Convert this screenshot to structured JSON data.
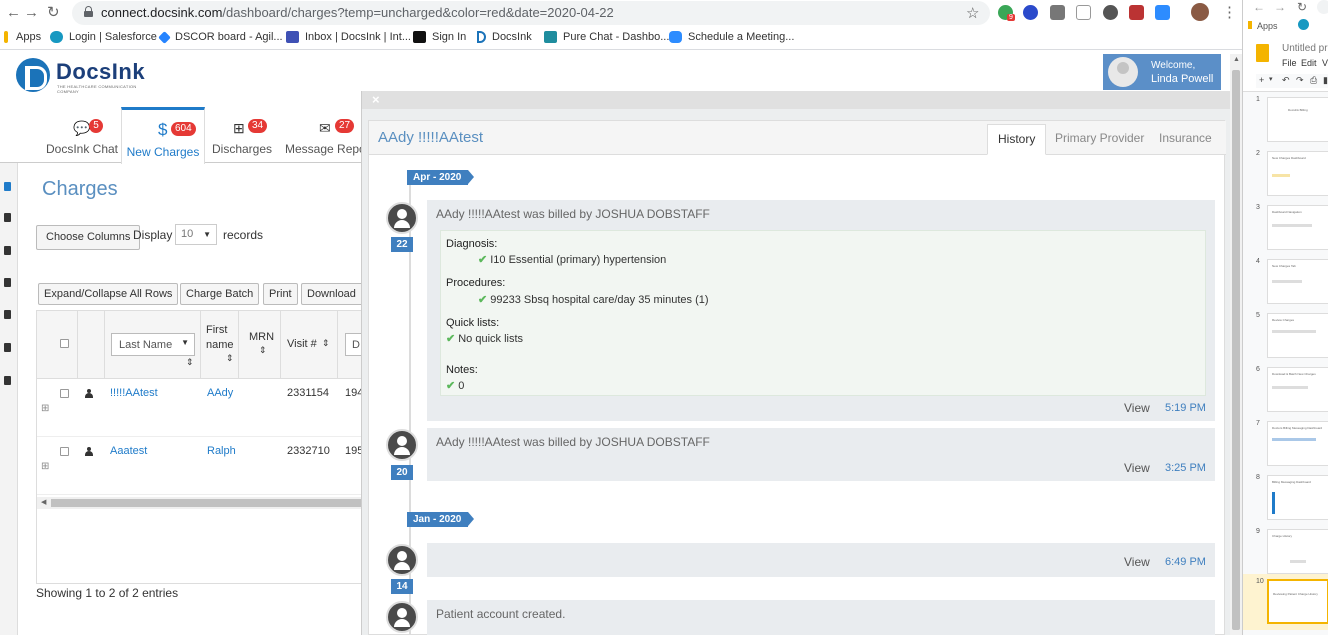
{
  "browser": {
    "url_host": "connect.docsink.com",
    "url_path": "/dashboard/charges?temp=uncharged&color=red&date=2020-04-22",
    "bookmarks": [
      "Apps",
      "Login | Salesforce",
      "DSCOR board - Agil...",
      "Inbox | DocsInk | Int...",
      "Sign In",
      "DocsInk",
      "Pure Chat - Dashbo...",
      "Schedule a Meeting..."
    ],
    "ext_badge": "9"
  },
  "app": {
    "logo_text": "DocsInk",
    "logo_sub": "THE HEALTHCARE COMMUNICATION COMPANY",
    "welcome_label": "Welcome,",
    "user_name": "Linda Powell",
    "tabs": [
      {
        "label": "DocsInk Chat",
        "badge": "5",
        "icon": "chat-icon"
      },
      {
        "label": "New Charges",
        "badge": "604",
        "icon": "dollar-icon"
      },
      {
        "label": "Discharges",
        "badge": "34",
        "icon": "hospital-icon"
      },
      {
        "label": "Message Report",
        "badge": "27",
        "icon": "envelope-icon"
      }
    ]
  },
  "charges": {
    "title": "Charges",
    "choose_columns": "Choose Columns",
    "display_label": "Display",
    "display_value": "10",
    "records_label": "records",
    "actions": [
      "Expand/Collapse All Rows",
      "Charge Batch",
      "Print",
      "Download"
    ],
    "columns": {
      "last_name": "Last Name",
      "first_name_1": "First",
      "first_name_2": "name",
      "mrn": "MRN",
      "visit": "Visit #",
      "next": "D"
    },
    "rows": [
      {
        "last": "!!!!!AAtest",
        "first": "AAdy",
        "visit": "2331154",
        "next": "194"
      },
      {
        "last": "Aaatest",
        "first": "Ralph",
        "visit": "2332710",
        "next": "195"
      }
    ],
    "footer": "Showing 1 to 2 of 2 entries"
  },
  "modal": {
    "close": "×",
    "title": "AAdy !!!!!AAtest",
    "tabs": [
      "History",
      "Primary Provider",
      "Insurance"
    ],
    "months": [
      "Apr - 2020",
      "Jan - 2020"
    ],
    "entries": [
      {
        "day": "22",
        "message": "AAdy !!!!!AAtest was billed by JOSHUA DOBSTAFF",
        "view": "View",
        "time": "5:19 PM",
        "details": {
          "diagnosis_label": "Diagnosis:",
          "diagnosis": "I10 Essential (primary) hypertension",
          "procedures_label": "Procedures:",
          "procedures": "99233 Sbsq hospital care/day 35 minutes (1)",
          "quicklists_label": "Quick lists:",
          "quicklists": "No quick lists",
          "notes_label": "Notes:",
          "notes": "0"
        }
      },
      {
        "day": "20",
        "message": "AAdy !!!!!AAtest was billed by JOSHUA DOBSTAFF",
        "view": "View",
        "time": "3:25 PM"
      },
      {
        "day": "14",
        "message": "",
        "view": "View",
        "time": "6:49 PM"
      },
      {
        "day": "",
        "message": "Patient account created."
      }
    ]
  },
  "docs": {
    "title": "Untitled pr",
    "apps": "Apps",
    "menu": [
      "File",
      "Edit",
      "V"
    ],
    "slide_numbers": [
      "1",
      "2",
      "3",
      "4",
      "5",
      "6",
      "7",
      "8",
      "9",
      "10"
    ],
    "slide_titles": [
      "DocsInk Billing",
      "New Charges Dashboard",
      "Dashboard Navigation",
      "New Charges Tab",
      "Review Charges",
      "Download & Batch New Charges",
      "Doctors Billing Messaging Dashboard",
      "Billing Messaging Dashboard",
      "Charge History",
      "Reviewing Patient Charge History"
    ]
  },
  "colors": {
    "accent": "#1f7bc9",
    "timeline": "#3f7fbf",
    "badge": "#e53935",
    "check": "#5cb85c"
  }
}
